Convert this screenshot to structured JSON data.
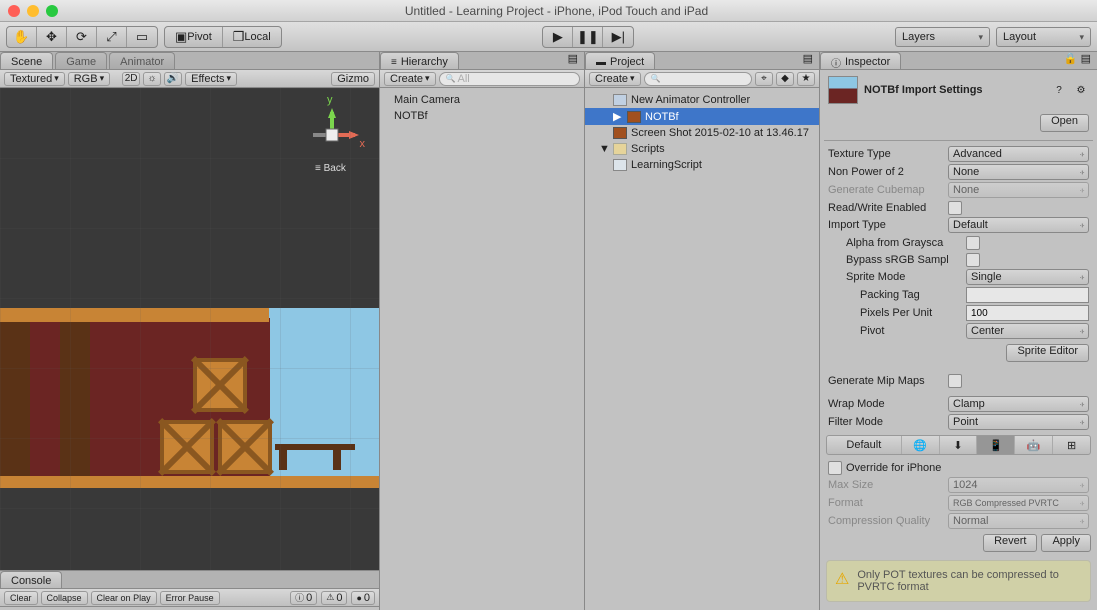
{
  "window": {
    "title": "Untitled - Learning Project - iPhone, iPod Touch and iPad"
  },
  "toolbar": {
    "transformTools": [
      "hand",
      "move",
      "rotate",
      "scale",
      "rect"
    ],
    "pivot": "Pivot",
    "local": "Local",
    "layers": "Layers",
    "layout": "Layout"
  },
  "scene": {
    "tabs": [
      "Scene",
      "Game",
      "Animator"
    ],
    "activeTab": 0,
    "shading": "Textured",
    "colorMode": "RGB",
    "badge2D": "2D",
    "effectsLabel": "Effects",
    "gizmoLabel": "Gizmo",
    "axisX": "x",
    "axisY": "y",
    "back": "≡ Back"
  },
  "hierarchy": {
    "title": "Hierarchy",
    "create": "Create",
    "searchPlaceholder": "All",
    "items": [
      "Main Camera",
      "NOTBf"
    ]
  },
  "project": {
    "title": "Project",
    "create": "Create",
    "searchPlaceholder": "",
    "items": [
      {
        "label": "New Animator Controller",
        "kind": "ctrl",
        "indent": 1
      },
      {
        "label": "NOTBf",
        "kind": "img",
        "indent": 1,
        "selected": true
      },
      {
        "label": "Screen Shot 2015-02-10 at 13.46.17",
        "kind": "img",
        "indent": 1
      },
      {
        "label": "Scripts",
        "kind": "folder",
        "indent": 0,
        "fold": "▼"
      },
      {
        "label": "LearningScript",
        "kind": "script",
        "indent": 1
      }
    ]
  },
  "inspector": {
    "title": "Inspector",
    "asset": "NOTBf Import Settings",
    "open": "Open",
    "textureType": {
      "label": "Texture Type",
      "value": "Advanced"
    },
    "npot": {
      "label": "Non Power of 2",
      "value": "None"
    },
    "cubemap": {
      "label": "Generate Cubemap",
      "value": "None"
    },
    "rw": {
      "label": "Read/Write Enabled",
      "checked": false
    },
    "importType": {
      "label": "Import Type",
      "value": "Default"
    },
    "alphaGray": {
      "label": "Alpha from Graysca",
      "checked": false
    },
    "bypassSRGB": {
      "label": "Bypass sRGB Sampl",
      "checked": false
    },
    "spriteMode": {
      "label": "Sprite Mode",
      "value": "Single"
    },
    "packingTag": {
      "label": "Packing Tag",
      "value": ""
    },
    "ppu": {
      "label": "Pixels Per Unit",
      "value": "100"
    },
    "pivotSprite": {
      "label": "Pivot",
      "value": "Center"
    },
    "spriteEditor": "Sprite Editor",
    "mipmaps": {
      "label": "Generate Mip Maps",
      "checked": false
    },
    "wrap": {
      "label": "Wrap Mode",
      "value": "Clamp"
    },
    "filter": {
      "label": "Filter Mode",
      "value": "Point"
    },
    "platformDefault": "Default",
    "override": {
      "label": "Override for iPhone",
      "checked": false
    },
    "maxSize": {
      "label": "Max Size",
      "value": "1024"
    },
    "format": {
      "label": "Format",
      "value": "RGB Compressed PVRTC"
    },
    "compression": {
      "label": "Compression Quality",
      "value": "Normal"
    },
    "revert": "Revert",
    "apply": "Apply",
    "warning": "Only POT textures can be compressed to PVRTC format"
  },
  "console": {
    "title": "Console",
    "clear": "Clear",
    "collapse": "Collapse",
    "clearOnPlay": "Clear on Play",
    "errorPause": "Error Pause",
    "counts": {
      "info": "0",
      "warn": "0",
      "err": "0"
    }
  }
}
